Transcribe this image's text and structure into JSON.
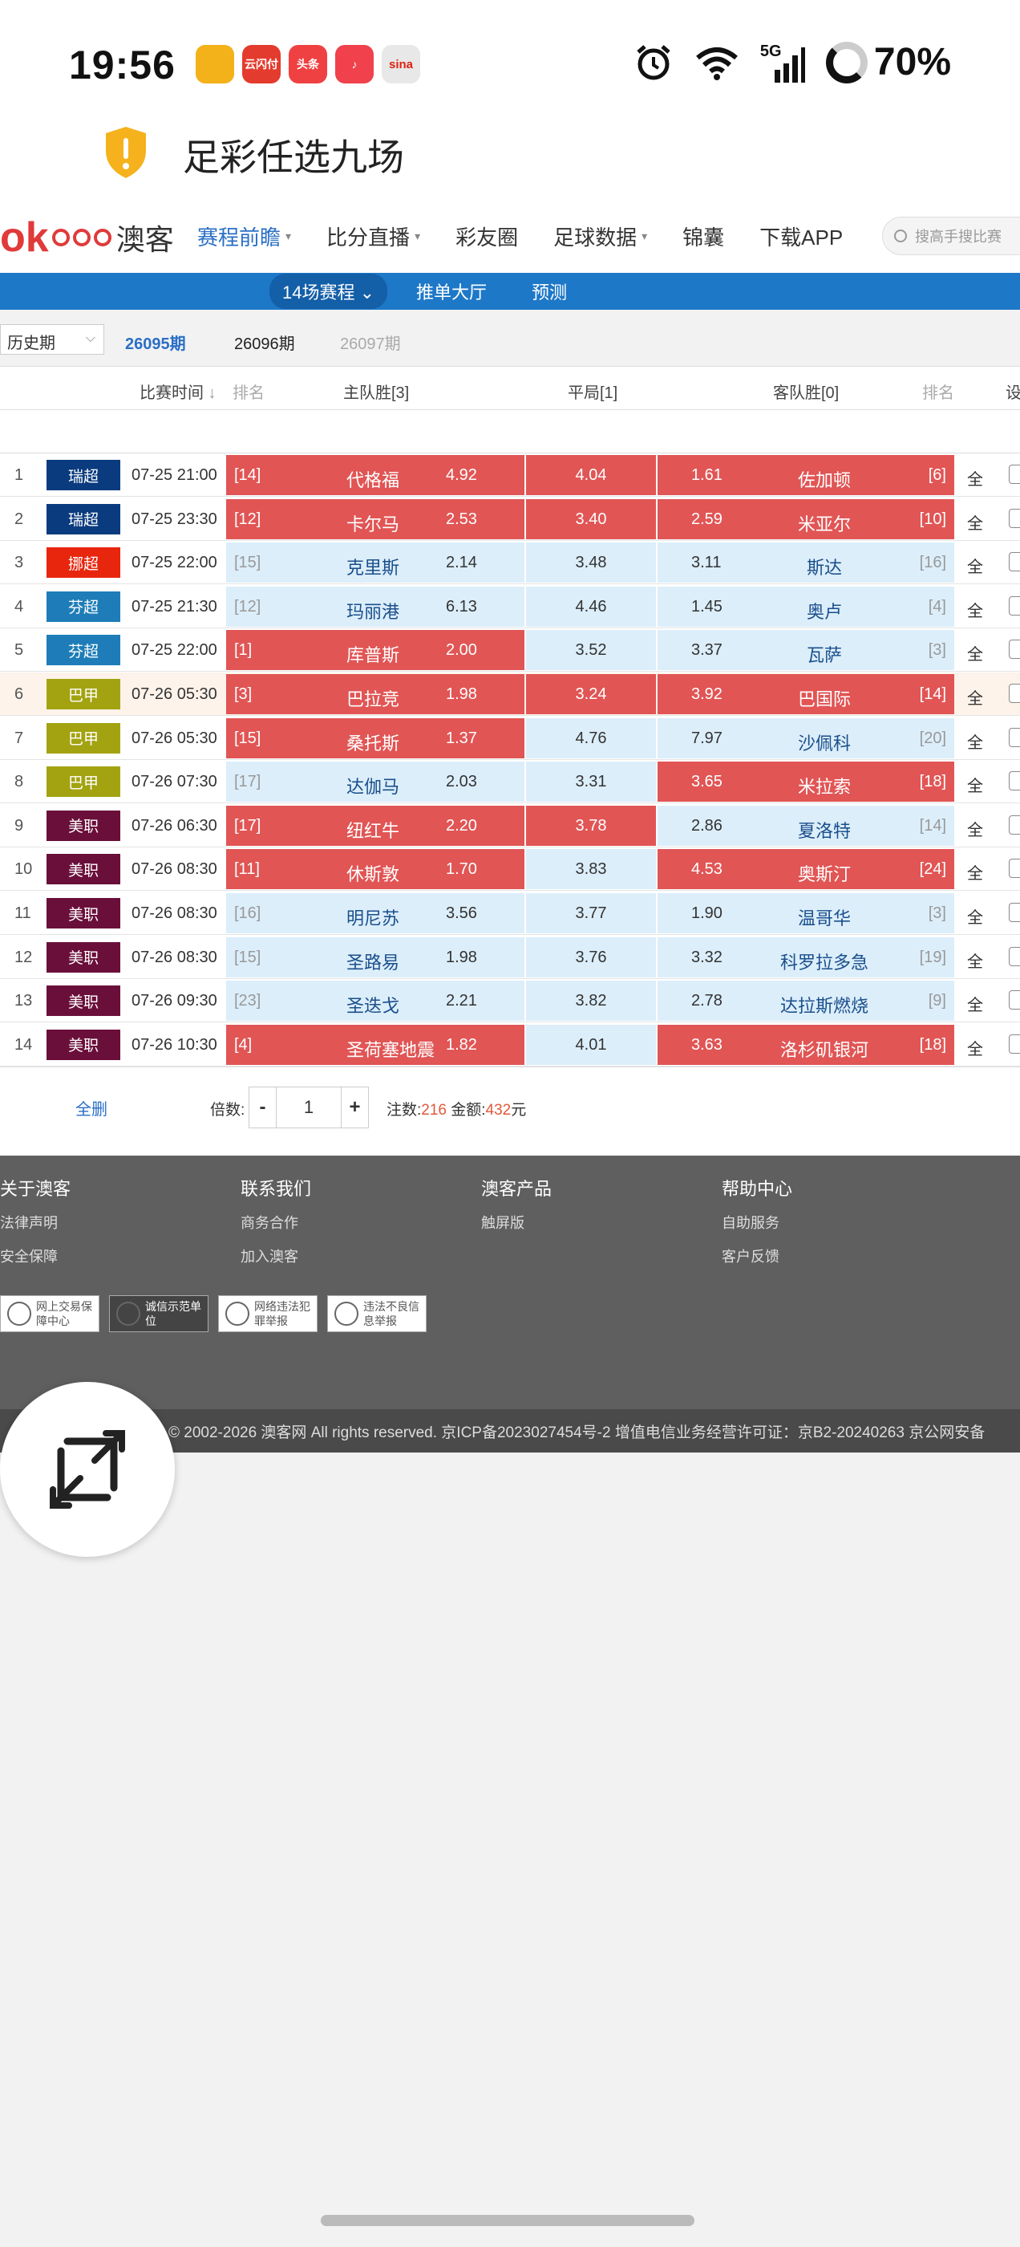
{
  "status": {
    "time": "19:56",
    "apps": [
      {
        "name": "car-app-icon",
        "label": "",
        "color": "#f3b21a"
      },
      {
        "name": "unionpay-app-icon",
        "label": "云闪付",
        "color": "#e33b2e"
      },
      {
        "name": "toutiao-app-icon",
        "label": "头条",
        "color": "#f04142"
      },
      {
        "name": "music-app-icon",
        "label": "♪",
        "color": "#f0414c"
      },
      {
        "name": "sina-app-icon",
        "label": "sina",
        "color": "#e8e8e8"
      }
    ],
    "network": "5G",
    "battery": "70%"
  },
  "title": "足彩任选九场",
  "nav": {
    "logo_text": "澳客",
    "items": [
      {
        "label": "赛程前瞻",
        "active": true,
        "caret": true
      },
      {
        "label": "比分直播",
        "active": false,
        "caret": true
      },
      {
        "label": "彩友圈",
        "active": false,
        "caret": false
      },
      {
        "label": "足球数据",
        "active": false,
        "caret": true
      },
      {
        "label": "锦囊",
        "active": false,
        "caret": false
      },
      {
        "label": "下载APP",
        "active": false,
        "caret": false
      }
    ],
    "search_placeholder": "搜高手搜比赛"
  },
  "subnav": {
    "pill": "14场赛程",
    "items": [
      "推单大厅",
      "预测"
    ]
  },
  "period": {
    "select": "历史期",
    "current": "26095期",
    "next": "26096期",
    "future": "26097期"
  },
  "table": {
    "headers": {
      "time": "比赛时间",
      "rank_home": "排名",
      "home": "主队胜[3]",
      "draw": "平局[1]",
      "away": "客队胜[0]",
      "rank_away": "排名",
      "settings": "设"
    },
    "rows": [
      {
        "idx": "1",
        "league": "瑞超",
        "league_color": "#0a3b7e",
        "time": "07-25 21:00",
        "home_rank": "[14]",
        "home": "代格福",
        "odds_h": "4.92",
        "odds_d": "4.04",
        "odds_a": "1.61",
        "away": "佐加顿",
        "away_rank": "[6]",
        "sel_h": true,
        "sel_d": true,
        "sel_a": true,
        "all": "全",
        "hl": false
      },
      {
        "idx": "2",
        "league": "瑞超",
        "league_color": "#0a3b7e",
        "time": "07-25 23:30",
        "home_rank": "[12]",
        "home": "卡尔马",
        "odds_h": "2.53",
        "odds_d": "3.40",
        "odds_a": "2.59",
        "away": "米亚尔",
        "away_rank": "[10]",
        "sel_h": true,
        "sel_d": true,
        "sel_a": true,
        "all": "全",
        "hl": false
      },
      {
        "idx": "3",
        "league": "挪超",
        "league_color": "#e8260e",
        "time": "07-25 22:00",
        "home_rank": "[15]",
        "home": "克里斯",
        "odds_h": "2.14",
        "odds_d": "3.48",
        "odds_a": "3.11",
        "away": "斯达",
        "away_rank": "[16]",
        "sel_h": false,
        "sel_d": false,
        "sel_a": false,
        "all": "全",
        "hl": false
      },
      {
        "idx": "4",
        "league": "芬超",
        "league_color": "#1e7db8",
        "time": "07-25 21:30",
        "home_rank": "[12]",
        "home": "玛丽港",
        "odds_h": "6.13",
        "odds_d": "4.46",
        "odds_a": "1.45",
        "away": "奥卢",
        "away_rank": "[4]",
        "sel_h": false,
        "sel_d": false,
        "sel_a": false,
        "all": "全",
        "hl": false
      },
      {
        "idx": "5",
        "league": "芬超",
        "league_color": "#1e7db8",
        "time": "07-25 22:00",
        "home_rank": "[1]",
        "home": "库普斯",
        "odds_h": "2.00",
        "odds_d": "3.52",
        "odds_a": "3.37",
        "away": "瓦萨",
        "away_rank": "[3]",
        "sel_h": true,
        "sel_d": false,
        "sel_a": false,
        "all": "全",
        "hl": false
      },
      {
        "idx": "6",
        "league": "巴甲",
        "league_color": "#a3a312",
        "time": "07-26 05:30",
        "home_rank": "[3]",
        "home": "巴拉竞",
        "odds_h": "1.98",
        "odds_d": "3.24",
        "odds_a": "3.92",
        "away": "巴国际",
        "away_rank": "[14]",
        "sel_h": true,
        "sel_d": true,
        "sel_a": true,
        "all": "全",
        "hl": true
      },
      {
        "idx": "7",
        "league": "巴甲",
        "league_color": "#a3a312",
        "time": "07-26 05:30",
        "home_rank": "[15]",
        "home": "桑托斯",
        "odds_h": "1.37",
        "odds_d": "4.76",
        "odds_a": "7.97",
        "away": "沙佩科",
        "away_rank": "[20]",
        "sel_h": true,
        "sel_d": false,
        "sel_a": false,
        "all": "全",
        "hl": false
      },
      {
        "idx": "8",
        "league": "巴甲",
        "league_color": "#a3a312",
        "time": "07-26 07:30",
        "home_rank": "[17]",
        "home": "达伽马",
        "odds_h": "2.03",
        "odds_d": "3.31",
        "odds_a": "3.65",
        "away": "米拉索",
        "away_rank": "[18]",
        "sel_h": false,
        "sel_d": false,
        "sel_a": true,
        "all": "全",
        "hl": false
      },
      {
        "idx": "9",
        "league": "美职",
        "league_color": "#6a0f3a",
        "time": "07-26 06:30",
        "home_rank": "[17]",
        "home": "纽红牛",
        "odds_h": "2.20",
        "odds_d": "3.78",
        "odds_a": "2.86",
        "away": "夏洛特",
        "away_rank": "[14]",
        "sel_h": true,
        "sel_d": true,
        "sel_a": false,
        "all": "全",
        "hl": false
      },
      {
        "idx": "10",
        "league": "美职",
        "league_color": "#6a0f3a",
        "time": "07-26 08:30",
        "home_rank": "[11]",
        "home": "休斯敦",
        "odds_h": "1.70",
        "odds_d": "3.83",
        "odds_a": "4.53",
        "away": "奥斯汀",
        "away_rank": "[24]",
        "sel_h": true,
        "sel_d": false,
        "sel_a": true,
        "all": "全",
        "hl": false
      },
      {
        "idx": "11",
        "league": "美职",
        "league_color": "#6a0f3a",
        "time": "07-26 08:30",
        "home_rank": "[16]",
        "home": "明尼苏",
        "odds_h": "3.56",
        "odds_d": "3.77",
        "odds_a": "1.90",
        "away": "温哥华",
        "away_rank": "[3]",
        "sel_h": false,
        "sel_d": false,
        "sel_a": false,
        "all": "全",
        "hl": false
      },
      {
        "idx": "12",
        "league": "美职",
        "league_color": "#6a0f3a",
        "time": "07-26 08:30",
        "home_rank": "[15]",
        "home": "圣路易",
        "odds_h": "1.98",
        "odds_d": "3.76",
        "odds_a": "3.32",
        "away": "科罗拉多急",
        "away_rank": "[19]",
        "sel_h": false,
        "sel_d": false,
        "sel_a": false,
        "all": "全",
        "hl": false
      },
      {
        "idx": "13",
        "league": "美职",
        "league_color": "#6a0f3a",
        "time": "07-26 09:30",
        "home_rank": "[23]",
        "home": "圣迭戈",
        "odds_h": "2.21",
        "odds_d": "3.82",
        "odds_a": "2.78",
        "away": "达拉斯燃烧",
        "away_rank": "[9]",
        "sel_h": false,
        "sel_d": false,
        "sel_a": false,
        "all": "全",
        "hl": false
      },
      {
        "idx": "14",
        "league": "美职",
        "league_color": "#6a0f3a",
        "time": "07-26 10:30",
        "home_rank": "[4]",
        "home": "圣荷塞地震",
        "odds_h": "1.82",
        "odds_d": "4.01",
        "odds_a": "3.63",
        "away": "洛杉矶银河",
        "away_rank": "[18]",
        "sel_h": true,
        "sel_d": false,
        "sel_a": true,
        "all": "全",
        "hl": false
      }
    ],
    "footer": {
      "delete_all": "全删",
      "multiplier_label": "倍数:",
      "minus": "-",
      "multiplier": "1",
      "plus": "+",
      "bets_label": "注数:",
      "bets": "216",
      "amount_label": "金额:",
      "amount": "432",
      "unit": "元"
    }
  },
  "footer": {
    "columns": [
      {
        "title": "关于澳客",
        "links": [
          "法律声明",
          "安全保障"
        ]
      },
      {
        "title": "联系我们",
        "links": [
          "商务合作",
          "加入澳客"
        ]
      },
      {
        "title": "澳客产品",
        "links": [
          "触屏版"
        ]
      },
      {
        "title": "帮助中心",
        "links": [
          "自助服务",
          "客户反馈"
        ]
      }
    ],
    "badges": [
      "网上交易保障中心",
      "诚信示范单位",
      "网络违法犯罪举报",
      "违法不良信息举报"
    ],
    "copyright": "© 2002-2026 澳客网  All rights reserved.   京ICP备2023027454号-2   增值电信业务经营许可证：京B2-20240263   京公网安备"
  }
}
